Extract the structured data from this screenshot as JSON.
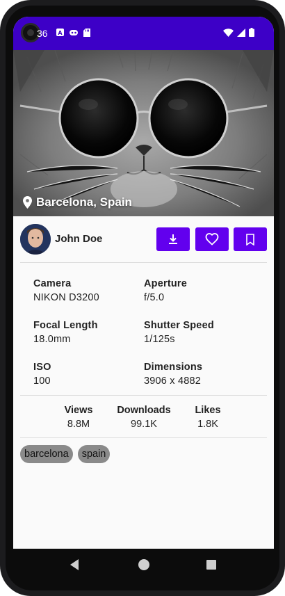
{
  "status_bar": {
    "time": "36",
    "icons_left": [
      "a-icon",
      "game-icon",
      "sd-card-icon"
    ],
    "icons_right": [
      "wifi-icon",
      "signal-icon",
      "battery-icon"
    ],
    "color": "#3d00c7"
  },
  "photo": {
    "description_icon": "location-pin-icon",
    "location": "Barcelona, Spain"
  },
  "author": {
    "name": "John Doe",
    "avatar_icon": "avatar-photo"
  },
  "actions": {
    "accent": "#6200ee",
    "buttons": [
      "download-icon",
      "heart-icon",
      "bookmark-icon"
    ]
  },
  "details": [
    {
      "label": "Camera",
      "value": "NIKON D3200"
    },
    {
      "label": "Aperture",
      "value": "f/5.0"
    },
    {
      "label": "Focal Length",
      "value": "18.0mm"
    },
    {
      "label": "Shutter Speed",
      "value": "1/125s"
    },
    {
      "label": "ISO",
      "value": "100"
    },
    {
      "label": "Dimensions",
      "value": "3906 x 4882"
    }
  ],
  "stats": [
    {
      "label": "Views",
      "value": "8.8M"
    },
    {
      "label": "Downloads",
      "value": "99.1K"
    },
    {
      "label": "Likes",
      "value": "1.8K"
    }
  ],
  "tags": [
    "barcelona",
    "spain"
  ],
  "nav": {
    "back_icon": "back-triangle-icon",
    "home_icon": "home-circle-icon",
    "recents_icon": "recents-square-icon"
  }
}
